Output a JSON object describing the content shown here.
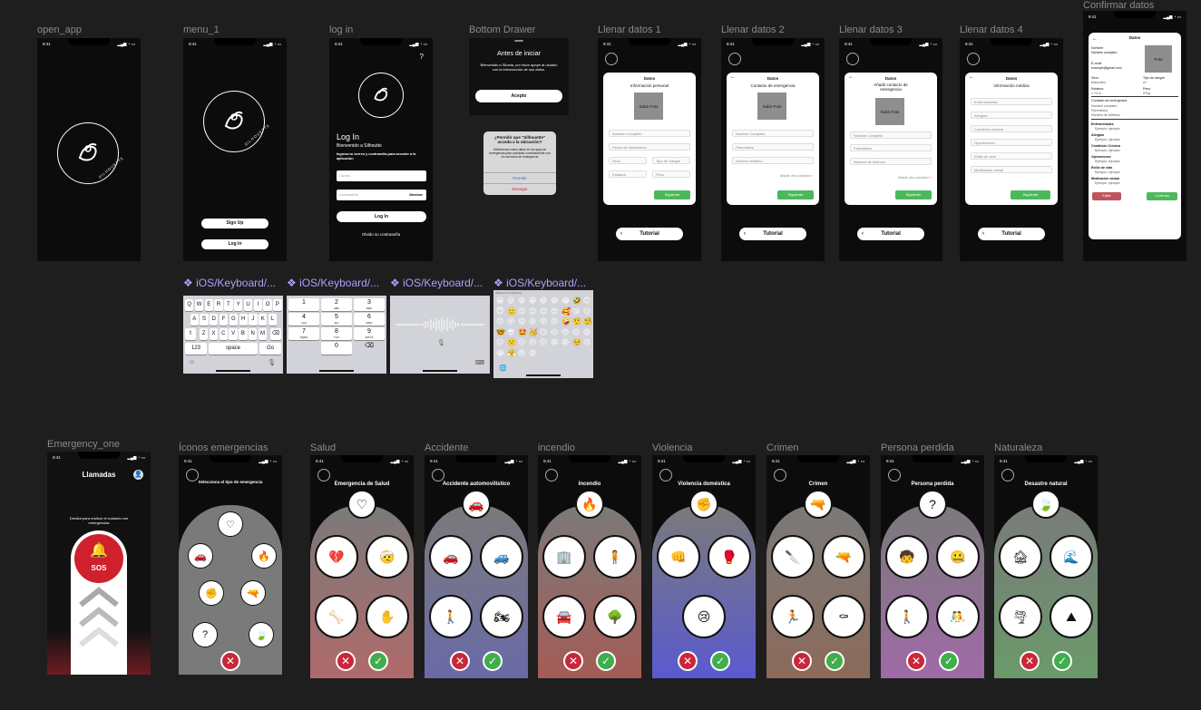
{
  "frames": {
    "open_app": {
      "label": "open_app",
      "time": "9:41",
      "brand": "SILHOUETTE"
    },
    "menu_1": {
      "label": "menu_1",
      "time": "9:41",
      "brand": "SILHOUETTE",
      "signup": "Sign Up",
      "login": "Log In"
    },
    "login": {
      "label": "log in",
      "time": "9:41",
      "help": "?",
      "title": "Log In",
      "welcome": "Bienvenido a Silhoutte",
      "instructions": "Ingresa tu correo y contraseña para acceder a la aplicación",
      "email_placeholder": "Correo",
      "password_placeholder": "Contraseña",
      "show": "Mostrar",
      "button": "Log In",
      "forgot": "Olvido su contraseña",
      "brand": "SILHOUETTE"
    },
    "bottom_drawer": {
      "label": "Bottom Drawer",
      "title": "Antes de iniciar",
      "body": "Bienvenido a Silueta, por favor apoye al usuario con la introducción de sus datos.",
      "accept": "Acepto",
      "alert_title": "¿Permitir que \"Silhouette\" acceda a la ubicación?",
      "alert_body": "Utilizaremos estos datos en las apps de emergencia para contactar correctamente con los servicios de emergencia",
      "allow": "Permitir",
      "deny": "Denegar"
    },
    "llenar1": {
      "label": "Llenar datos 1",
      "time": "9:41",
      "header": "Datos",
      "sub": "Información personal",
      "photo": "Subir Foto",
      "f1": "Nombre Completo",
      "f2": "Fecha de Nacimiento",
      "f3": "Sexo",
      "f4": "Tipo de Sangre",
      "f5": "Estatura",
      "f6": "Peso",
      "next": "Siguiente",
      "tutorial": "Tutorial"
    },
    "llenar2": {
      "label": "Llenar datos 2",
      "time": "9:41",
      "back": "←",
      "header": "Datos",
      "sub": "Contacto de emergencia",
      "photo": "Subir Foto",
      "f1": "Nombre Completo",
      "f2": "Parentesco",
      "f3": "Número teléfono",
      "add": "Añadir otro contacto +",
      "next": "Siguiente",
      "tutorial": "Tutorial"
    },
    "llenar3": {
      "label": "Llenar datos 3",
      "time": "9:41",
      "back": "←",
      "header": "Datos",
      "sub": "Añadir contacto de emergencia",
      "photo": "Subir Foto",
      "f1": "Nombre Completo",
      "f2": "Parentesco",
      "f3": "Número de teléfono",
      "add": "Añadir otro contacto +",
      "next": "Siguiente",
      "tutorial": "Tutorial"
    },
    "llenar4": {
      "label": "Llenar datos 4",
      "time": "9:41",
      "back": "←",
      "header": "Datos",
      "sub": "Información médica",
      "f1": "Enfermedades",
      "f2": "Alergias",
      "f3": "Condición crónica",
      "f4": "Operaciones",
      "f5": "Estilo de vida",
      "f6": "Medicación actual",
      "next": "Siguiente",
      "tutorial": "Tutorial"
    },
    "confirmar": {
      "label": "Confirmar datos",
      "time": "9:41",
      "back": "←",
      "header": "Datos",
      "photo": "Foto",
      "l_nombre": "Nombre:",
      "v_nombre": "Nombre completo",
      "l_email": "E-mail",
      "v_email": "example@gmail.com",
      "l_sexo": "Sexo",
      "v_sexo": "Masculino",
      "l_sangre": "Tipo de sangre",
      "v_sangre": "A+",
      "l_estatura": "Estatura",
      "v_estatura": "1.73 m",
      "l_peso": "Peso",
      "v_peso": "57kg",
      "l_contacto": "Contacto de emergencia",
      "v_c1": "Nombre completo",
      "v_c2": "Parentesco",
      "v_c3": "Número de teléfono",
      "l_enf": "Enfermedades",
      "v_enf": "Ejemplo, ejemplo",
      "l_ale": "Alergias",
      "v_ale": "Ejemplo, ejemplo",
      "l_cond": "Condición Crónica",
      "v_cond": "Ejemplo, ejemplo",
      "l_ope": "Operaciones",
      "v_ope": "Ejemplo, ejemplo",
      "l_est": "Estilo de vida",
      "v_est": "Ejemplo, ejemplo",
      "l_med": "Medicación actual",
      "v_med": "Ejemplo, ejemplo",
      "edit": "Editar",
      "confirm": "Confirmar"
    },
    "emergency_one": {
      "label": "Emergency_one",
      "time": "9:41",
      "title": "Llamadas",
      "hint": "Desliza para realizar el contacto con emergencias",
      "sos": "SOS"
    },
    "iconos": {
      "label": "Íconos emergencias",
      "time": "9:41",
      "title": "Selecciona el tipo de emergencia"
    },
    "salud": {
      "label": "Salud",
      "time": "9:41",
      "title": "Emergencia de Salud"
    },
    "accidente": {
      "label": "Accidente",
      "time": "9:41",
      "title": "Accidente automovilístico"
    },
    "incendio": {
      "label": "incendio",
      "time": "9:41",
      "title": "Incendio"
    },
    "violencia": {
      "label": "Violencia",
      "time": "9:41",
      "title": "Violencia doméstica"
    },
    "crimen": {
      "label": "Crimen",
      "time": "9:41",
      "title": "Crimen"
    },
    "persona": {
      "label": "Persona perdida",
      "time": "9:41",
      "title": "Persona perdida"
    },
    "naturaleza": {
      "label": "Naturaleza",
      "time": "9:41",
      "title": "Desastre natural"
    }
  },
  "keyboards": {
    "labels": [
      "❖ iOS/Keyboard/...",
      "❖ iOS/Keyboard/...",
      "❖ iOS/Keyboard/...",
      "❖ iOS/Keyboard/..."
    ],
    "qwerty_row1": [
      "Q",
      "W",
      "E",
      "R",
      "T",
      "Y",
      "U",
      "I",
      "O",
      "P"
    ],
    "qwerty_row2": [
      "A",
      "S",
      "D",
      "F",
      "G",
      "H",
      "J",
      "K",
      "L"
    ],
    "qwerty_row3": [
      "Z",
      "X",
      "C",
      "V",
      "B",
      "N",
      "M"
    ],
    "k_123": "123",
    "k_space": "space",
    "k_go": "Go",
    "num_keys": [
      [
        "1",
        ""
      ],
      [
        "2",
        "ABC"
      ],
      [
        "3",
        "DEF"
      ],
      [
        "4",
        "GHI"
      ],
      [
        "5",
        "JKL"
      ],
      [
        "6",
        "MNO"
      ],
      [
        "7",
        "PQRS"
      ],
      [
        "8",
        "TUV"
      ],
      [
        "9",
        "WXYZ"
      ],
      [
        "",
        ""
      ],
      [
        "0",
        ""
      ],
      [
        "⌫",
        ""
      ]
    ],
    "emoji_header": "SMILEYS & PEOPLE"
  },
  "colors": {
    "canvas": "#1e1e1e",
    "accent_green": "#4cb85c",
    "danger": "#c8283a",
    "component_label": "#b59cff"
  }
}
